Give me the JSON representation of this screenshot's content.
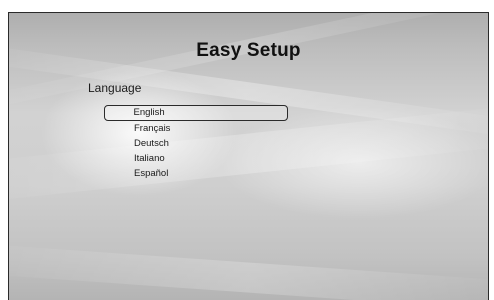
{
  "screen": {
    "title": "Easy Setup",
    "section_label": "Language"
  },
  "language_menu": {
    "selected_index": 0,
    "items": [
      {
        "label": "English"
      },
      {
        "label": "Français"
      },
      {
        "label": "Deutsch"
      },
      {
        "label": "Italiano"
      },
      {
        "label": "Español"
      }
    ]
  }
}
